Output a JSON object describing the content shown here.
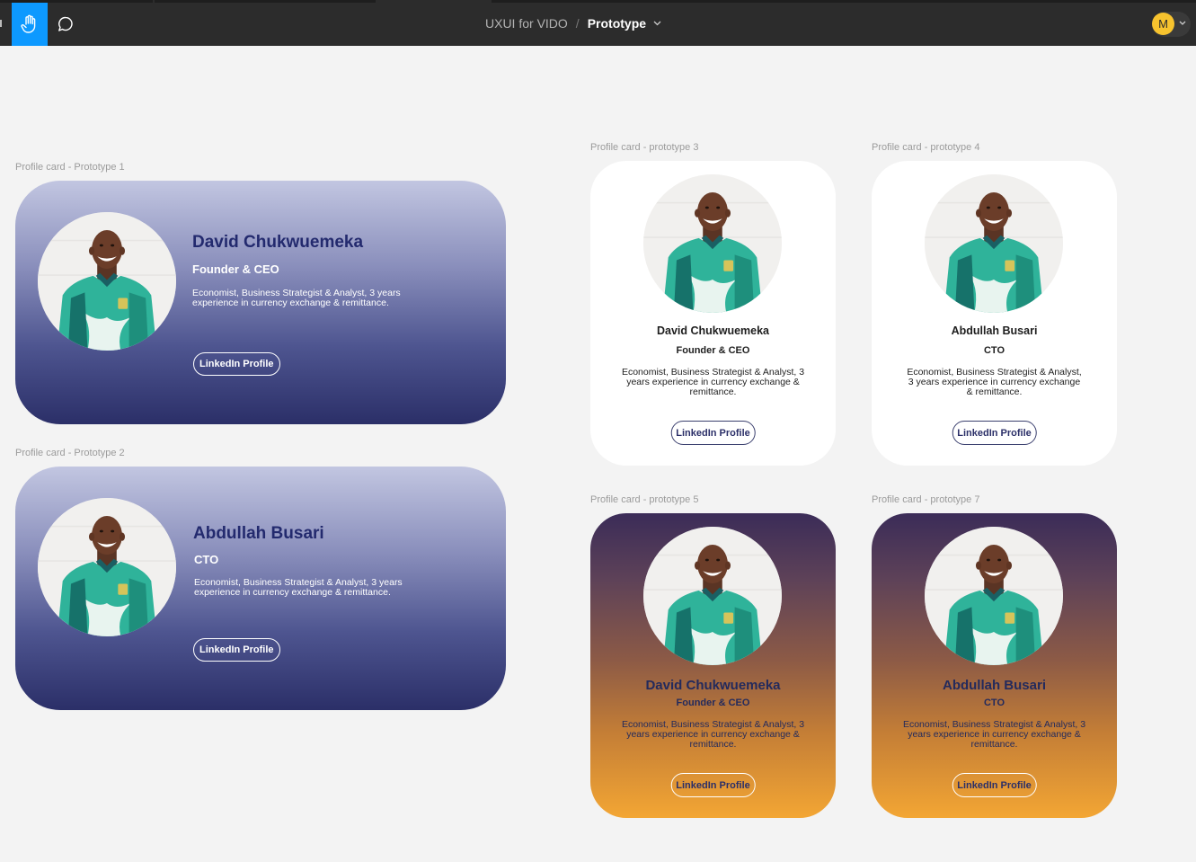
{
  "toolbar": {
    "file_name": "UXUI for VIDO",
    "separator": "/",
    "page_name": "Prototype",
    "avatar_initial": "M",
    "hand_tool_active": true,
    "accent_color": "#0d99ff",
    "avatar_color": "#f7c32e"
  },
  "frames": {
    "p1": {
      "label": "Profile card - Prototype 1",
      "name": "David Chukwuemeka",
      "role": "Founder & CEO",
      "desc": "Economist, Business Strategist & Analyst, 3 years experience in currency exchange & remittance.",
      "button": "LinkedIn Profile"
    },
    "p2": {
      "label": "Profile card - Prototype 2",
      "name": "Abdullah Busari",
      "role": "CTO",
      "desc": "Economist, Business Strategist & Analyst, 3 years experience in currency exchange & remittance.",
      "button": "LinkedIn Profile"
    },
    "p3": {
      "label": "Profile card - prototype 3",
      "name": "David Chukwuemeka",
      "role": "Founder & CEO",
      "desc": "Economist, Business Strategist & Analyst, 3 years experience in currency exchange & remittance.",
      "button": "LinkedIn Profile"
    },
    "p4": {
      "label": "Profile card - prototype 4",
      "name": "Abdullah Busari",
      "role": "CTO",
      "desc": "Economist, Business Strategist & Analyst, 3 years experience in currency exchange & remittance.",
      "button": "LinkedIn Profile"
    },
    "p5": {
      "label": "Profile card - prototype 5",
      "name": "David Chukwuemeka",
      "role": "Founder & CEO",
      "desc": "Economist, Business Strategist & Analyst, 3 years experience in currency exchange & remittance.",
      "button": "LinkedIn Profile"
    },
    "p7": {
      "label": "Profile card - prototype 7",
      "name": "Abdullah Busari",
      "role": "CTO",
      "desc": "Economist, Business Strategist & Analyst, 3 years experience in currency exchange & remittance.",
      "button": "LinkedIn Profile"
    }
  },
  "colors": {
    "canvas": "#f3f3f3",
    "card_blue_top": "#c2c6e1",
    "card_blue_bottom": "#2b2f68",
    "name_navy": "#232a6e",
    "sunset_top": "#3b2c58",
    "sunset_bottom": "#f3a634"
  },
  "icons": {
    "hand_tool": "hand-icon",
    "comment_tool": "comment-icon",
    "page_menu": "chevron-down-icon"
  }
}
